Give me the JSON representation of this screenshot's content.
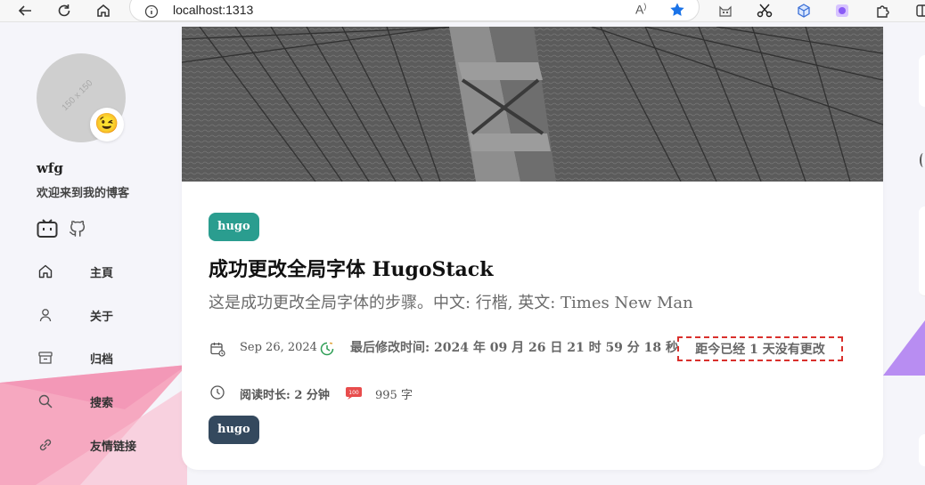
{
  "browser": {
    "url": "localhost:1313",
    "read_aloud_label": "Aᴬ"
  },
  "sidebar": {
    "avatar_placeholder": "150 x 150",
    "avatar_emoji": "😉",
    "site_name": "wfg",
    "site_description": "欢迎来到我的博客",
    "menu": [
      {
        "label": "主頁",
        "icon": "home-icon"
      },
      {
        "label": "关于",
        "icon": "user-icon"
      },
      {
        "label": "归档",
        "icon": "archive-icon"
      },
      {
        "label": "搜索",
        "icon": "search-icon"
      },
      {
        "label": "友情链接",
        "icon": "link-icon"
      }
    ]
  },
  "article": {
    "top_tag": "hugo",
    "title": "成功更改全局字体 HugoStack",
    "subtitle": "这是成功更改全局字体的步骤。中文: 行楷, 英文: Times New Man",
    "date": "Sep 26, 2024",
    "last_modified": "最后修改时间: 2024 年 09 月 26 日 21 时 59 分 18 秒",
    "unchanged_notice": "距今已经 1 天没有更改",
    "reading_time": "阅读时长: 2 分钟",
    "word_count": "995 字",
    "bottom_tag": "hugo"
  },
  "colors": {
    "top_tag": "#2a9d8f",
    "bottom_tag": "#34495e",
    "notice_border": "#d9302c",
    "accent_pink": "#f4a2b9",
    "accent_purple": "#b08cf5"
  }
}
